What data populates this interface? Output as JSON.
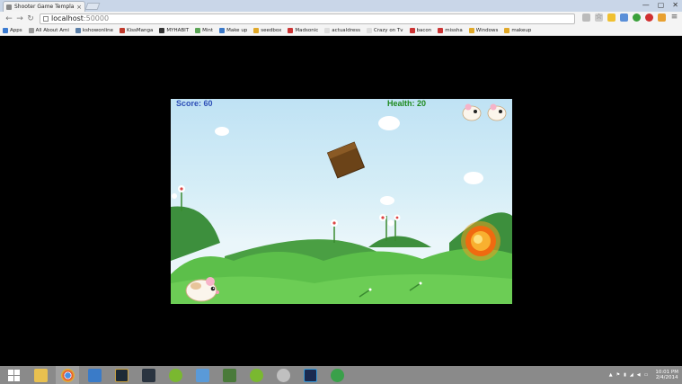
{
  "browser": {
    "tab_title": "Shooter Game Templa",
    "tab_close": "×",
    "win_minimize": "—",
    "win_restore": "▢",
    "win_close": "✕",
    "back": "←",
    "forward": "→",
    "reload": "↻",
    "url_host": "localhost",
    "url_port": ":50000"
  },
  "bookmarks": [
    {
      "label": "Apps",
      "color": "#3b7bd1"
    },
    {
      "label": "All About Ami",
      "color": "#999999"
    },
    {
      "label": "kshowonline",
      "color": "#5b7fa8"
    },
    {
      "label": "KissManga",
      "color": "#c0392b"
    },
    {
      "label": "MYHABIT",
      "color": "#333333"
    },
    {
      "label": "Mint",
      "color": "#5aa455"
    },
    {
      "label": "Make up",
      "color": "#3a78c8"
    },
    {
      "label": "seedbox",
      "color": "#e0a828"
    },
    {
      "label": "Madsonic",
      "color": "#cc3333"
    },
    {
      "label": "actualdress",
      "color": "#dddddd"
    },
    {
      "label": "Crazy on Tv",
      "color": "#dddddd"
    },
    {
      "label": "bacon",
      "color": "#cc3333"
    },
    {
      "label": "missha",
      "color": "#cc3333"
    },
    {
      "label": "Windows",
      "color": "#e0a828"
    },
    {
      "label": "makeup",
      "color": "#e0a828"
    }
  ],
  "game": {
    "score_text": "Score: 60",
    "health_text": "Health: 20",
    "lives": 2
  },
  "taskbar": {
    "time": "10:01 PM",
    "date": "2/4/2014"
  }
}
